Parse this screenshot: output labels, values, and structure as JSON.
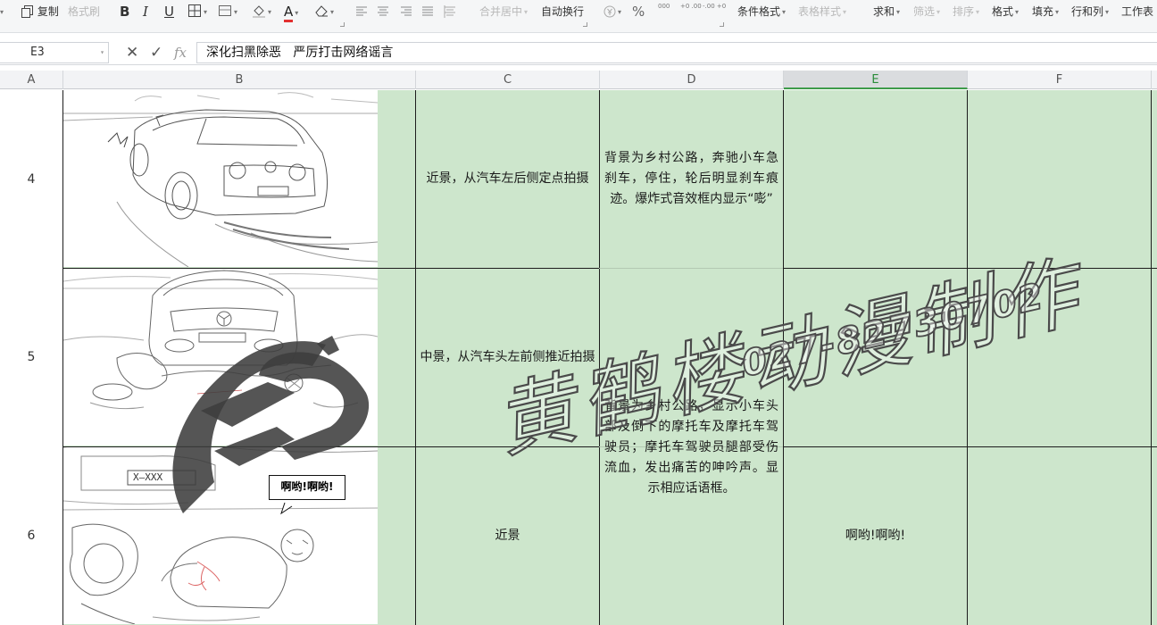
{
  "toolbar": {
    "copy_label": "复制",
    "format_painter_label": "格式刷",
    "merge_center_label": "合并居中",
    "auto_wrap_label": "自动换行",
    "percent_symbol": "%",
    "thousands_symbol": "000",
    "decimal_add_symbol": "+0 .00",
    "decimal_remove_symbol": "-.00 +0",
    "conditional_format_label": "条件格式",
    "table_style_label": "表格样式",
    "sum_label": "求和",
    "filter_label": "筛选",
    "sort_label": "排序",
    "format_label": "格式",
    "fill_label": "填充",
    "row_col_label": "行和列",
    "worksheet_label": "工作表",
    "bold_label": "B",
    "italic_label": "I",
    "underline_label": "U",
    "font_color_label": "A"
  },
  "formula_bar": {
    "cell_ref": "E3",
    "fx_label": "fx",
    "cancel_symbol": "✕",
    "confirm_symbol": "✓",
    "content": "深化扫黑除恶   严厉打击网络谣言"
  },
  "columns": [
    "A",
    "B",
    "C",
    "D",
    "E",
    "F"
  ],
  "active_column": "E",
  "rows": [
    {
      "num": "4",
      "shot": "近景，从汽车左后侧定点拍摄",
      "description": "背景为乡村公路，奔驰小车急刹车，停住，轮后明显刹车痕迹。爆炸式音效框内显示“嘭”",
      "dialogue": ""
    },
    {
      "num": "5",
      "shot": "中景，从汽车头左前侧推近拍摄",
      "description": "背景为乡村公路，显示小车头部及倒下的摩托车及摩托车驾驶员；摩托车驾驶员腿部受伤流血，发出痛苦的呻吟声。显示相应话语框。",
      "dialogue": ""
    },
    {
      "num": "6",
      "shot": "近景",
      "description": "",
      "dialogue": "啊哟!啊哟!"
    }
  ],
  "panel": {
    "speech_bubble": "啊哟!啊哟!",
    "plate_front": "X—XXX",
    "plate_back": "X—XXX"
  },
  "watermark": {
    "studio_name": "黄鹤楼动漫制作",
    "phone": "027-82730702"
  },
  "colors": {
    "cell_fill": "#cde6cc",
    "active_header_text": "#2a8c3a",
    "gridline": "#1d1d1d"
  }
}
